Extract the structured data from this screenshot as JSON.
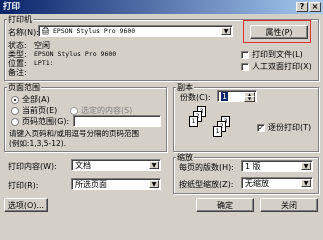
{
  "window": {
    "title": "打印"
  },
  "printer": {
    "group_label": "打印机",
    "name_label": "名称(N):",
    "name_value": "EPSON Stylus Pro 9600",
    "properties_button": "属性(P)",
    "status_label": "状态:",
    "status_value": "空闲",
    "type_label": "类型:",
    "type_value": "EPSON Stylus Pro 9600",
    "where_label": "位置:",
    "where_value": "LPT1:",
    "comment_label": "备注:",
    "print_to_file": "打印到文件(L)",
    "manual_duplex": "人工双面打印(X)"
  },
  "page_range": {
    "group_label": "页面范围",
    "all": "全部(A)",
    "current": "当前页(E)",
    "selection": "选定的内容(S)",
    "pages": "页码范围(G):",
    "pages_value": "",
    "help_line1": "请键入页码和/或用逗号分隔的页码范围",
    "help_line2": "(例如:1,3,5-12)."
  },
  "copies": {
    "group_label": "副本",
    "count_label": "份数(C):",
    "count_value": "1",
    "collate": "逐份打印(T)",
    "page_labels": [
      "3",
      "2",
      "1",
      "3",
      "2",
      "1"
    ]
  },
  "print_what": {
    "label": "打印内容(W):",
    "value": "文档"
  },
  "print": {
    "label": "打印(R):",
    "value": "所选页面"
  },
  "zoom": {
    "group_label": "缩放",
    "pages_per_sheet_label": "每页的版数(H):",
    "pages_per_sheet_value": "1 版",
    "scale_label": "按纸型缩放(Z):",
    "scale_value": "无缩放"
  },
  "buttons": {
    "options": "选项(O)...",
    "ok": "确定",
    "cancel": "关闭"
  },
  "colors": {
    "highlight_box": "#e03030"
  }
}
